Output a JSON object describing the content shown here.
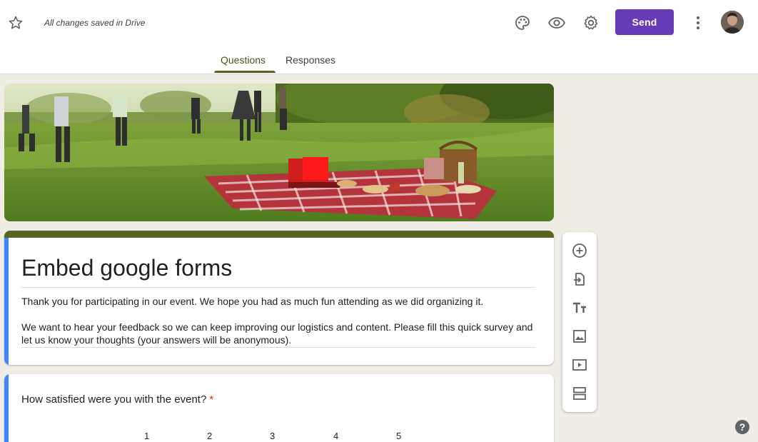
{
  "header": {
    "save_status": "All changes saved in Drive",
    "send_label": "Send",
    "icons": [
      "star-icon",
      "palette-icon",
      "eye-icon",
      "gear-icon",
      "more-vert-icon"
    ]
  },
  "tabs": [
    {
      "label": "Questions",
      "active": true
    },
    {
      "label": "Responses",
      "active": false
    }
  ],
  "form": {
    "title": "Embed google forms",
    "description_1": "Thank you for participating in our event. We hope you had as much fun attending as we did organizing it.",
    "description_2": "We want to hear your feedback so we can keep improving our logistics and content. Please fill this quick survey and let us know your thoughts (your answers will be anonymous)."
  },
  "question": {
    "text": "How satisfied were you with the event?",
    "required_mark": "*",
    "scale": [
      "1",
      "2",
      "3",
      "4",
      "5"
    ]
  },
  "toolbar": {
    "tools": [
      "add-question-icon",
      "import-questions-icon",
      "add-title-icon",
      "add-image-icon",
      "add-video-icon",
      "add-section-icon"
    ]
  },
  "help_label": "?",
  "colors": {
    "accent_purple": "#673ab7",
    "theme_olive": "#5a6320",
    "left_accent_blue": "#4285f4",
    "background": "#efede6"
  }
}
